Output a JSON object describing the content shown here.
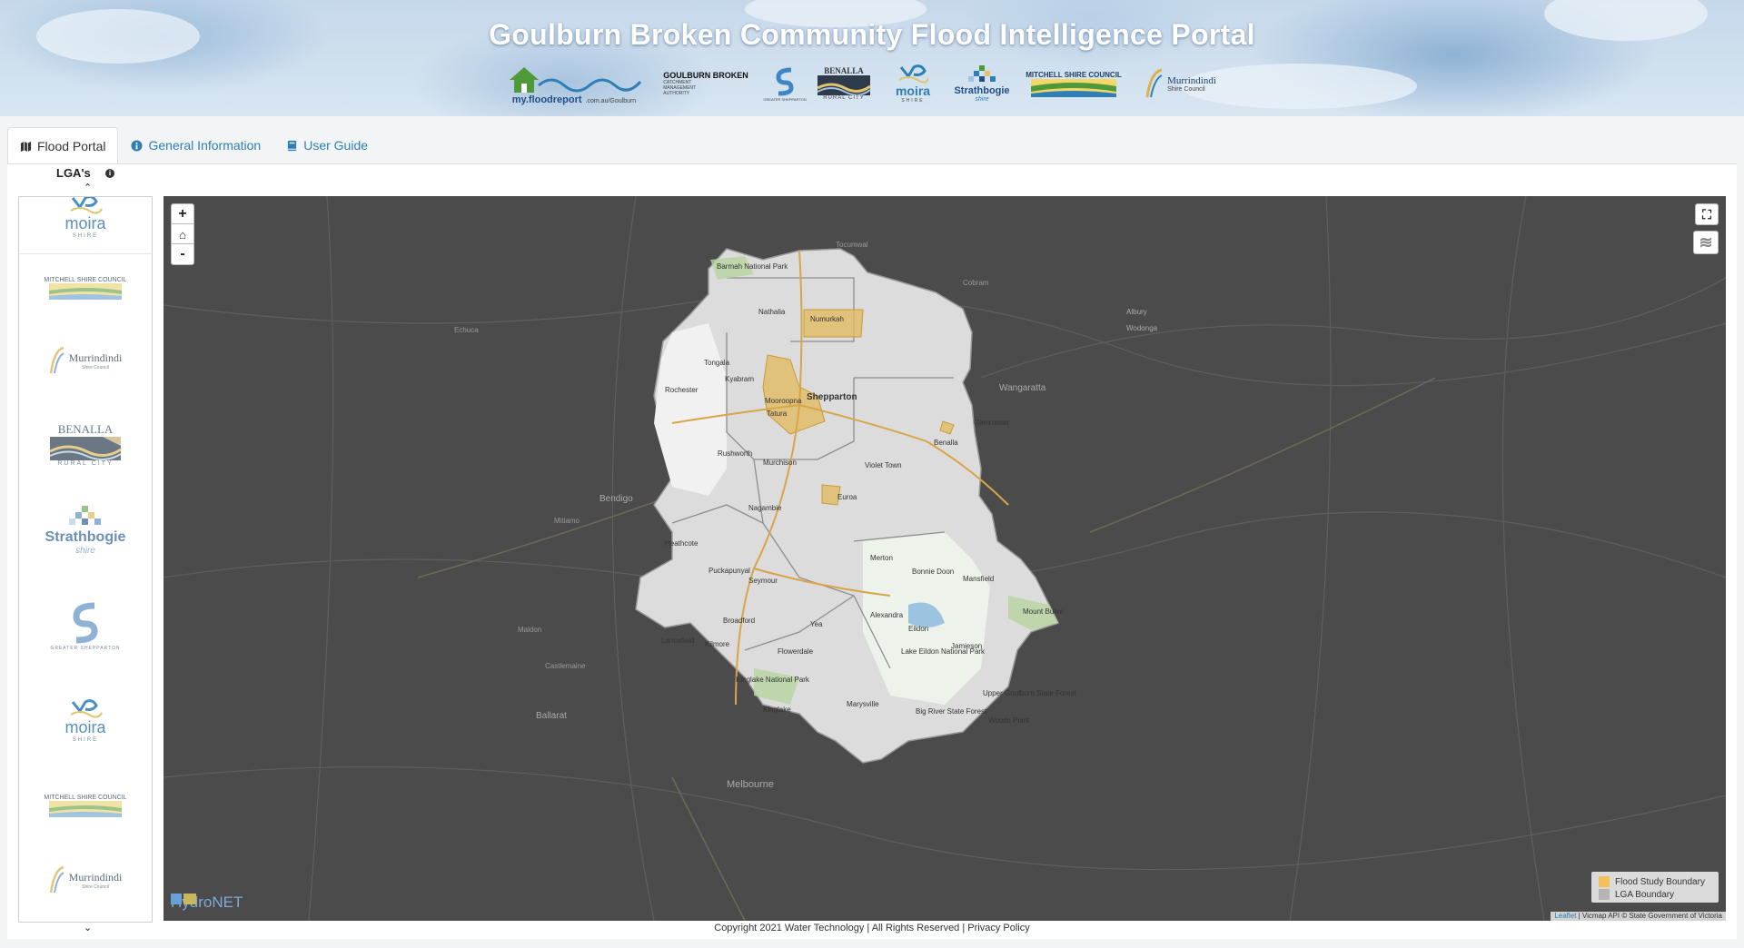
{
  "header": {
    "title": "Goulburn Broken Community Flood Intelligence Portal",
    "logos": [
      {
        "name": "my-floodreport-logo",
        "label": "my.floodreport",
        "sub": ".com.au/Goulburn"
      },
      {
        "name": "goulburn-broken-cma-logo",
        "label": "GOULBURN BROKEN",
        "sub": "CATCHMENT MANAGEMENT AUTHORITY"
      },
      {
        "name": "greater-shepparton-logo",
        "label": "",
        "sub": "GREATER SHEPPARTON"
      },
      {
        "name": "benalla-logo",
        "label": "BENALLA",
        "sub": "RURAL CITY"
      },
      {
        "name": "moira-logo",
        "label": "moira",
        "sub": "SHIRE"
      },
      {
        "name": "strathbogie-logo",
        "label": "Strathbogie",
        "sub": "shire"
      },
      {
        "name": "mitchell-logo",
        "label": "MITCHELL SHIRE COUNCIL",
        "sub": ""
      },
      {
        "name": "murrindindi-logo",
        "label": "Murrindindi",
        "sub": "Shire Council"
      }
    ]
  },
  "tabs": [
    {
      "label": "Flood Portal",
      "icon": "map-icon",
      "active": true
    },
    {
      "label": "General Information",
      "icon": "info-icon",
      "active": false
    },
    {
      "label": "User Guide",
      "icon": "book-icon",
      "active": false
    }
  ],
  "sidebar": {
    "title": "LGA's",
    "info_icon": "i",
    "up": "⌃",
    "down": "⌄",
    "items": [
      {
        "label": "moira",
        "sub": "SHIRE"
      },
      {
        "label": "MITCHELL SHIRE COUNCIL",
        "sub": ""
      },
      {
        "label": "Murrindindi",
        "sub": "Shire Council"
      },
      {
        "label": "BENALLA",
        "sub": "RURAL CITY"
      },
      {
        "label": "Strathbogie",
        "sub": "shire"
      },
      {
        "label": "",
        "sub": "GREATER SHEPPARTON"
      },
      {
        "label": "moira",
        "sub": "SHIRE"
      },
      {
        "label": "MITCHELL SHIRE COUNCIL",
        "sub": ""
      },
      {
        "label": "Murrindindi",
        "sub": "Shire Council"
      }
    ]
  },
  "map": {
    "zoom_in": "+",
    "home": "⌂",
    "zoom_out": "-",
    "fullscreen": "⛶",
    "layers": "≋",
    "towns": [
      "Barmah National Park",
      "Nathalia",
      "Numurkah",
      "Tongala",
      "Kyabram",
      "Shepparton",
      "Mooroopna",
      "Tatura",
      "Rochester",
      "Rushworth",
      "Murchison",
      "Violet Town",
      "Benalla",
      "Glenrowan",
      "Nagambie",
      "Euroa",
      "Heathcote",
      "Puckapunyal",
      "Seymour",
      "Broadford",
      "Kilmore",
      "Lancefield",
      "Yea",
      "Alexandra",
      "Flowerdale",
      "Kinglake National Park",
      "Kinglake",
      "Marysville",
      "Merton",
      "Bonnie Doon",
      "Mansfield",
      "Mount Buller",
      "Eildon",
      "Jamieson",
      "Lake Eildon National Park",
      "Upper Goulburn State Forest",
      "Woods Point",
      "Big River State Forest",
      "Echuca",
      "Bendigo",
      "Ballarat",
      "Melbourne",
      "Wangaratta",
      "Albury",
      "Wodonga",
      "Cobram",
      "Tocumwal",
      "Mitiamo",
      "Maldon",
      "Castlemaine"
    ],
    "legend": [
      {
        "label": "Flood Study Boundary",
        "color": "#f2c15a"
      },
      {
        "label": "LGA Boundary",
        "color": "#b5b5b5"
      }
    ],
    "attribution": {
      "leaflet": "Leaflet",
      "rest": " | Vicmap API © State Government of Victoria"
    },
    "watermark": "HydroNET"
  },
  "footer": {
    "copyright": "Copyright 2021 Water Technology | All Rights Reserved | ",
    "privacy": "Privacy Policy"
  }
}
